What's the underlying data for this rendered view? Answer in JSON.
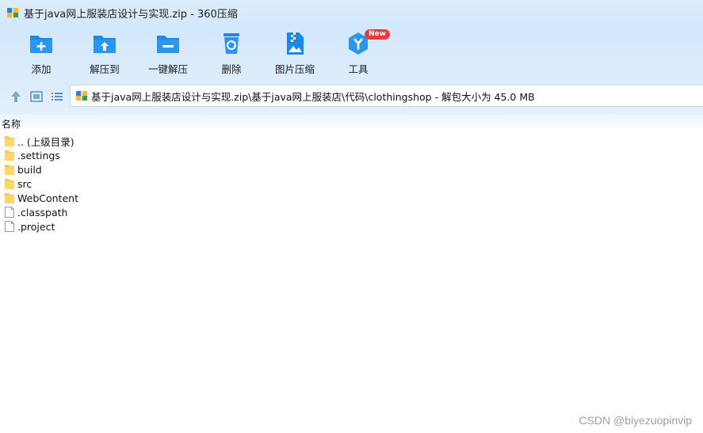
{
  "window": {
    "title": "基于java网上服装店设计与实现.zip - 360压缩"
  },
  "toolbar": {
    "items": [
      {
        "label": "添加",
        "icon": "add-icon"
      },
      {
        "label": "解压到",
        "icon": "extract-to-icon"
      },
      {
        "label": "一键解压",
        "icon": "one-click-extract-icon"
      },
      {
        "label": "删除",
        "icon": "delete-icon"
      },
      {
        "label": "图片压缩",
        "icon": "image-compress-icon"
      },
      {
        "label": "工具",
        "icon": "tools-icon",
        "badge": "New"
      }
    ]
  },
  "navigation": {
    "path": "基于java网上服装店设计与实现.zip\\基于java网上服装店\\代码\\clothingshop - 解包大小为 45.0 MB"
  },
  "filelist": {
    "column_name": "名称",
    "items": [
      {
        "name": ".. (上级目录)",
        "type": "folder"
      },
      {
        "name": ".settings",
        "type": "folder"
      },
      {
        "name": "build",
        "type": "folder"
      },
      {
        "name": "src",
        "type": "folder"
      },
      {
        "name": "WebContent",
        "type": "folder"
      },
      {
        "name": ".classpath",
        "type": "file"
      },
      {
        "name": ".project",
        "type": "file"
      }
    ]
  },
  "watermark": "CSDN @biyezuopinvip",
  "colors": {
    "accent": "#1e88e5",
    "titlebar": "#d3e8fb",
    "folder": "#ffd66b",
    "badge": "#e8393b"
  }
}
